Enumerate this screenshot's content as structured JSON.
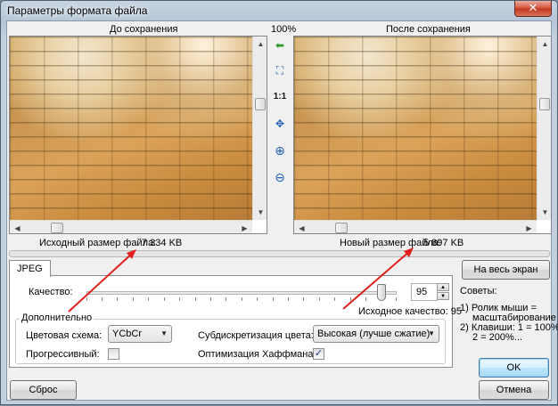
{
  "window": {
    "title": "Параметры формата файла",
    "close_glyph": "✕"
  },
  "preview": {
    "zoom_label": "100%",
    "before_label": "До сохранения",
    "after_label": "После сохранения",
    "original_size_label": "Исходный размер файла:",
    "original_size_value": "7 334 KB",
    "new_size_label": "Новый размер файла:",
    "new_size_value": "5 897 KB"
  },
  "toolbar": {
    "tools": [
      {
        "name": "back-arrow-icon",
        "glyph": "⬅"
      },
      {
        "name": "fit-window-icon",
        "glyph": "⛶"
      },
      {
        "name": "actual-size-icon",
        "glyph": "1:1"
      },
      {
        "name": "pan-icon",
        "glyph": "✥"
      },
      {
        "name": "zoom-in-icon",
        "glyph": "⊕"
      },
      {
        "name": "zoom-out-icon",
        "glyph": "⊖"
      }
    ]
  },
  "tabs": [
    {
      "label": "JPEG",
      "active": true
    }
  ],
  "quality": {
    "label": "Качество:",
    "value": "95",
    "min": 0,
    "max": 100,
    "original_quality_label": "Исходное качество: 95"
  },
  "advanced": {
    "group_label": "Дополнительно",
    "color_scheme_label": "Цветовая схема:",
    "color_scheme_value": "YCbCr",
    "subsampling_label": "Субдискретизация цвета:",
    "subsampling_value": "Высокая (лучше сжатие)",
    "progressive_label": "Прогрессивный:",
    "progressive_checked": false,
    "huffman_label": "Оптимизация Хаффмана:",
    "huffman_checked": true
  },
  "buttons": {
    "fullscreen": "На весь экран",
    "ok": "OK",
    "cancel": "Отмена",
    "reset": "Сброс"
  },
  "tips": {
    "title": "Советы:",
    "lines": [
      "1) Ролик мыши =",
      "масштабирование",
      "2) Клавиши: 1 = 100%,",
      "2 = 200%..."
    ]
  },
  "colors": {
    "annotation_arrow": "#e0201a",
    "accent_blue": "#1d5fb4"
  }
}
